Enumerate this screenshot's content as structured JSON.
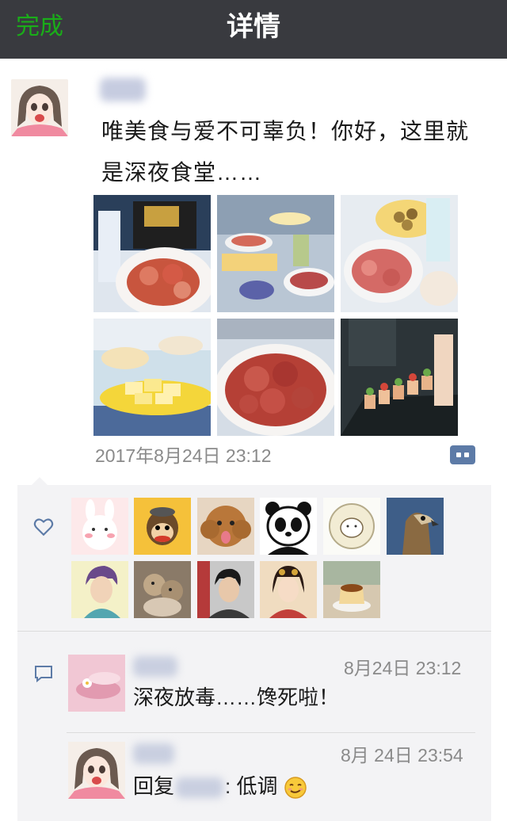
{
  "header": {
    "done_label": "完成",
    "title": "详情"
  },
  "post": {
    "text": "唯美食与爱不可辜负！你好，这里就是深夜食堂……",
    "timestamp": "2017年8月24日 23:12",
    "photos": [
      "prosciutto-platter",
      "party-food-table",
      "ham-and-olives",
      "cheese-cubes",
      "salami-plate",
      "skewer-appetizers"
    ]
  },
  "likes": {
    "avatars": [
      "cony-sticker",
      "monkey-cartoon",
      "poodle",
      "panda-sticker",
      "hamster-sketch",
      "falcon",
      "boy-portrait",
      "monkeys-photo",
      "man-portrait",
      "ancient-beauty-painting",
      "pudding"
    ]
  },
  "comments": [
    {
      "time": "8月24日 23:12",
      "text": "深夜放毒……馋死啦！"
    },
    {
      "time": "8月 24日  23:54",
      "reply_prefix": "回复",
      "reply_suffix": ": 低调",
      "emoji": "smirk-emoji"
    }
  ],
  "colors": {
    "accent": "#1aad19",
    "topbar": "#393a3f",
    "link": "#5d7ba7",
    "panel": "#f3f3f5"
  }
}
